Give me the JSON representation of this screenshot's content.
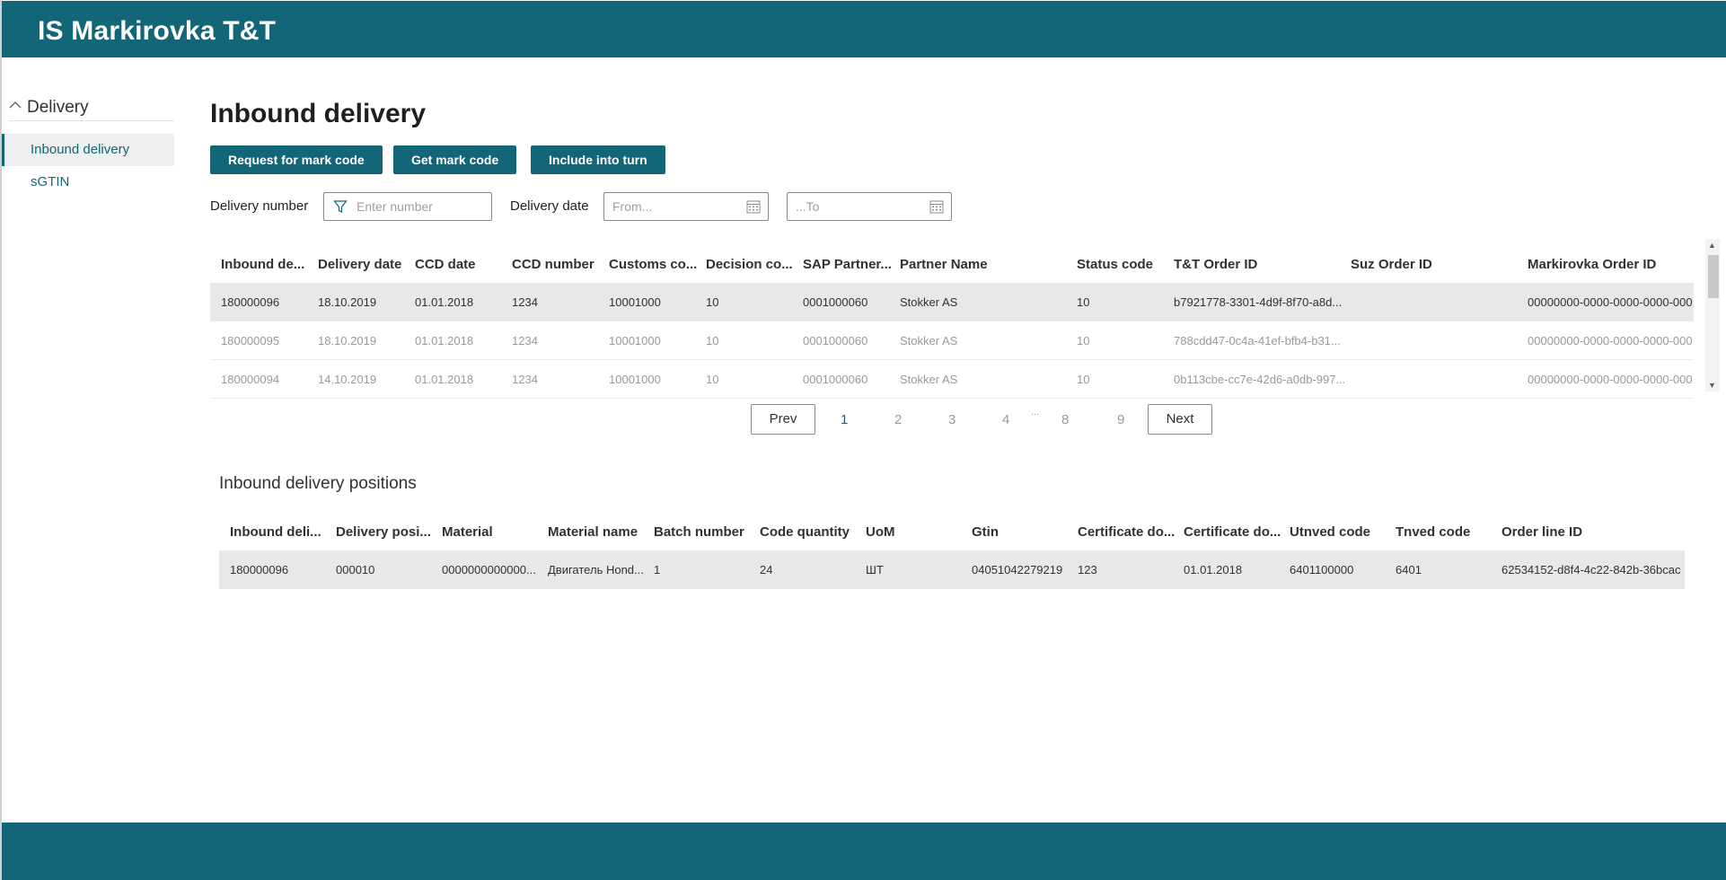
{
  "app": {
    "title": "IS Markirovka T&T"
  },
  "sidebar": {
    "group_label": "Delivery",
    "items": [
      {
        "label": "Inbound delivery",
        "active": true
      },
      {
        "label": "sGTIN",
        "active": false
      }
    ]
  },
  "page": {
    "title": "Inbound delivery"
  },
  "toolbar": {
    "request_label": "Request for mark code",
    "get_label": "Get mark code",
    "include_label": "Include into turn"
  },
  "filters": {
    "delivery_number_label": "Delivery number",
    "delivery_number_placeholder": "Enter number",
    "delivery_date_label": "Delivery date",
    "from_placeholder": "From...",
    "to_placeholder": "...To"
  },
  "deliveries": {
    "columns": [
      "Inbound de...",
      "Delivery date",
      "CCD date",
      "CCD number",
      "Customs co...",
      "Decision co...",
      "SAP Partner...",
      "Partner Name",
      "Status code",
      "T&T Order ID",
      "Suz Order ID",
      "Markirovka Order ID"
    ],
    "rows": [
      [
        "180000096",
        "18.10.2019",
        "01.01.2018",
        "1234",
        "10001000",
        "10",
        "0001000060",
        "Stokker AS",
        "10",
        "b7921778-3301-4d9f-8f70-a8d...",
        "",
        "00000000-0000-0000-0000-000..."
      ],
      [
        "180000095",
        "18.10.2019",
        "01.01.2018",
        "1234",
        "10001000",
        "10",
        "0001000060",
        "Stokker AS",
        "10",
        "788cdd47-0c4a-41ef-bfb4-b31...",
        "",
        "00000000-0000-0000-0000-000..."
      ],
      [
        "180000094",
        "14.10.2019",
        "01.01.2018",
        "1234",
        "10001000",
        "10",
        "0001000060",
        "Stokker AS",
        "10",
        "0b113cbe-cc7e-42d6-a0db-997...",
        "",
        "00000000-0000-0000-0000-000..."
      ]
    ]
  },
  "pager": {
    "prev_label": "Prev",
    "next_label": "Next",
    "pages": [
      "1",
      "2",
      "3",
      "4",
      "...",
      "8",
      "9"
    ],
    "current": "1"
  },
  "positions": {
    "title": "Inbound delivery positions",
    "columns": [
      "Inbound deli...",
      "Delivery posi...",
      "Material",
      "Material name",
      "Batch number",
      "Code quantity",
      "UoM",
      "Gtin",
      "Certificate do...",
      "Certificate do...",
      "Utnved code",
      "Tnved code",
      "Order line ID"
    ],
    "rows": [
      [
        "180000096",
        "000010",
        "0000000000000...",
        "Двигатель Hond...",
        "1",
        "24",
        "ШТ",
        "04051042279219",
        "123",
        "01.01.2018",
        "6401100000",
        "6401",
        "62534152-d8f4-4c22-842b-36bcac..."
      ]
    ]
  },
  "colors": {
    "brand": "#126677",
    "selected_row": "#e8e8e8"
  }
}
